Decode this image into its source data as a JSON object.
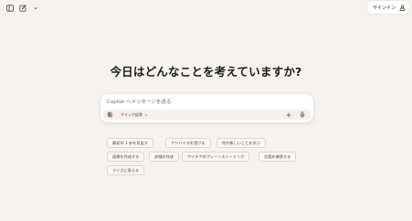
{
  "header": {
    "signin_label": "サインイン"
  },
  "main": {
    "headline": "今日はどんなことを考えていますか?"
  },
  "composer": {
    "placeholder": "Copilot へメッセージを送る",
    "mode_label": "クイック応答"
  },
  "suggestions": [
    "最初の 1 歩を見出す",
    "アドバイスを受ける",
    "何か新しいことを学ぶ",
    "画像を作成する",
    "詳細の作成",
    "アイデアのブレーンストーミング",
    "言語を練習する",
    "クイズに答える"
  ],
  "colors": {
    "background": "#f6f2ee",
    "composer_bar": "#f7efe9"
  }
}
